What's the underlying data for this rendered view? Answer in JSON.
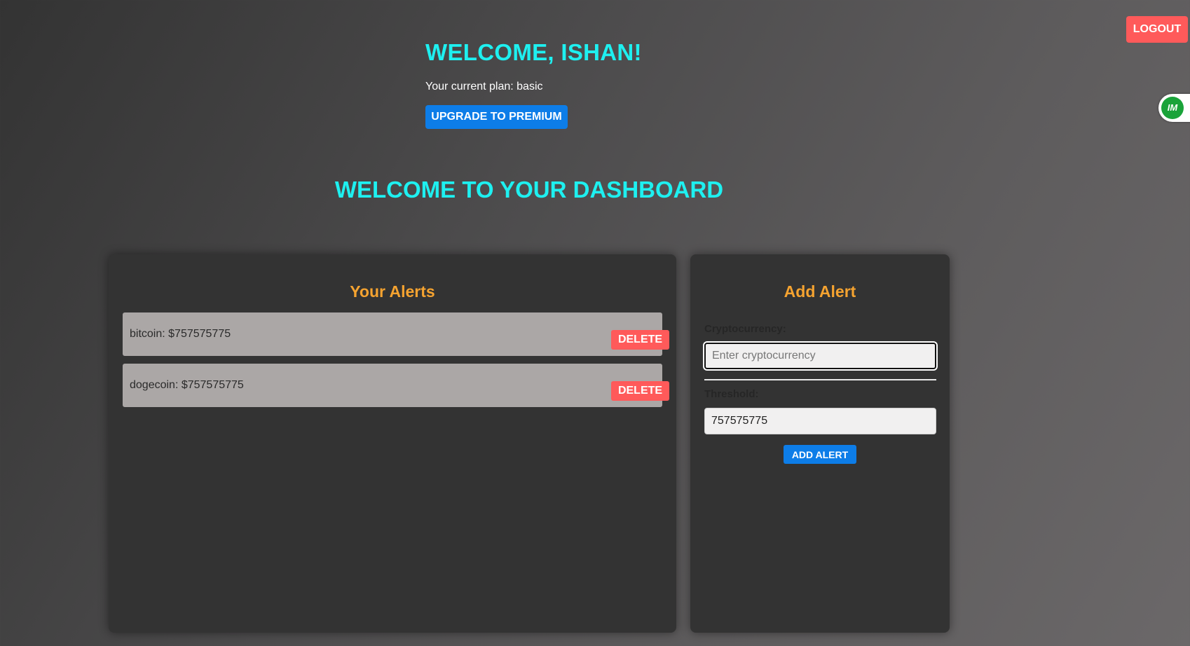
{
  "header": {
    "logout_label": "LOGOUT",
    "welcome": "WELCOME, ISHAN!",
    "plan_text": "Your current plan: basic",
    "upgrade_label": "UPGRADE TO PREMIUM",
    "dashboard_title": "WELCOME TO YOUR DASHBOARD"
  },
  "extension": {
    "badge": "IM",
    "icon": "extension-badge-icon",
    "menu_icon": "kebab-menu-icon"
  },
  "alerts": {
    "title": "Your Alerts",
    "items": [
      {
        "text": "bitcoin: $757575775",
        "delete_label": "DELETE"
      },
      {
        "text": "dogecoin: $757575775",
        "delete_label": "DELETE"
      }
    ]
  },
  "add_alert": {
    "title": "Add Alert",
    "crypto_label": "Cryptocurrency:",
    "crypto_placeholder": "Enter cryptocurrency",
    "crypto_value": "",
    "threshold_label": "Threshold:",
    "threshold_value": "757575775",
    "submit_label": "ADD ALERT"
  },
  "colors": {
    "accent_cyan": "#1ef0f0",
    "accent_orange": "#f5a330",
    "primary_blue": "#0d7de8",
    "danger_red": "#ff5a5a",
    "panel_bg": "#333333",
    "alert_item_bg": "#aba7a6"
  }
}
